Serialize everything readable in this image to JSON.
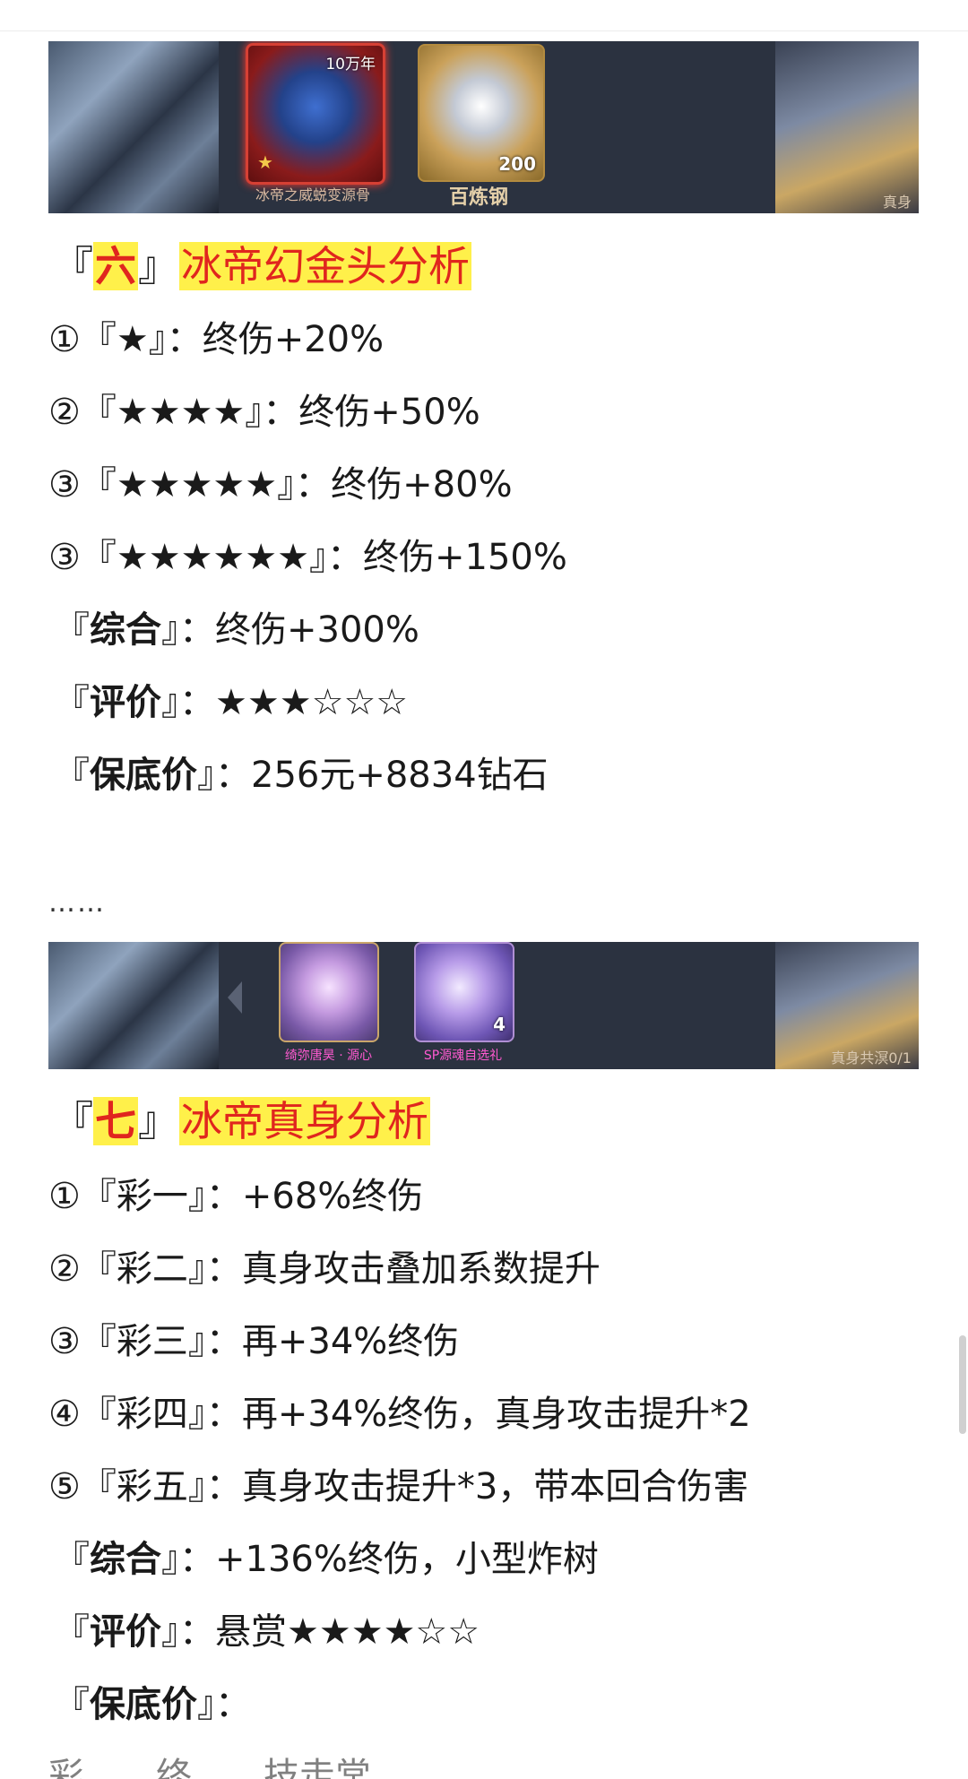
{
  "banner1": {
    "item1_badge": "10万年",
    "item1_caption": "冰帝之威蜕变源骨",
    "item2_count": "200",
    "item2_caption": "百炼钢",
    "right_text": "真身"
  },
  "section6": {
    "bracket_open": "『",
    "number": "六",
    "bracket_close": "』",
    "title": "冰帝幻金头分析",
    "lines": [
      {
        "prefix": "①『★』：",
        "text": "终伤+20%"
      },
      {
        "prefix": "②『★★★★』：",
        "text": "终伤+50%"
      },
      {
        "prefix": "③『★★★★★』：",
        "text": "终伤+80%"
      },
      {
        "prefix": "③『★★★★★★』：",
        "text": "终伤+150%"
      }
    ],
    "summary_label": "综合",
    "summary_text": "终伤+300%",
    "rating_label": "评价",
    "rating_text": "★★★☆☆☆",
    "price_label": "保底价",
    "price_text": "256元+8834钻石"
  },
  "ellipsis": "……",
  "banner2": {
    "item1_caption": "绮弥唐昊 · 源心",
    "item2_caption": "SP源魂自选礼",
    "item2_count": "4",
    "right_text": "真身共溟0/1"
  },
  "section7": {
    "bracket_open": "『",
    "number": "七",
    "bracket_close": "』",
    "title": "冰帝真身分析",
    "lines": [
      {
        "prefix": "①『彩一』：",
        "text": "+68%终伤"
      },
      {
        "prefix": "②『彩二』：",
        "text": "真身攻击叠加系数提升"
      },
      {
        "prefix": "③『彩三』：",
        "text": "再+34%终伤"
      },
      {
        "prefix": "④『彩四』：",
        "text": "再+34%终伤，真身攻击提升*2"
      },
      {
        "prefix": "⑤『彩五』：",
        "text": "真身攻击提升*3，带本回合伤害"
      }
    ],
    "summary_label": "综合",
    "summary_text": "+136%终伤，小型炸树",
    "rating_label": "评价",
    "rating_text": "悬赏★★★★☆☆",
    "price_label": "保底价",
    "price_text": ""
  },
  "cut_off_line": "彩……终……技走常"
}
